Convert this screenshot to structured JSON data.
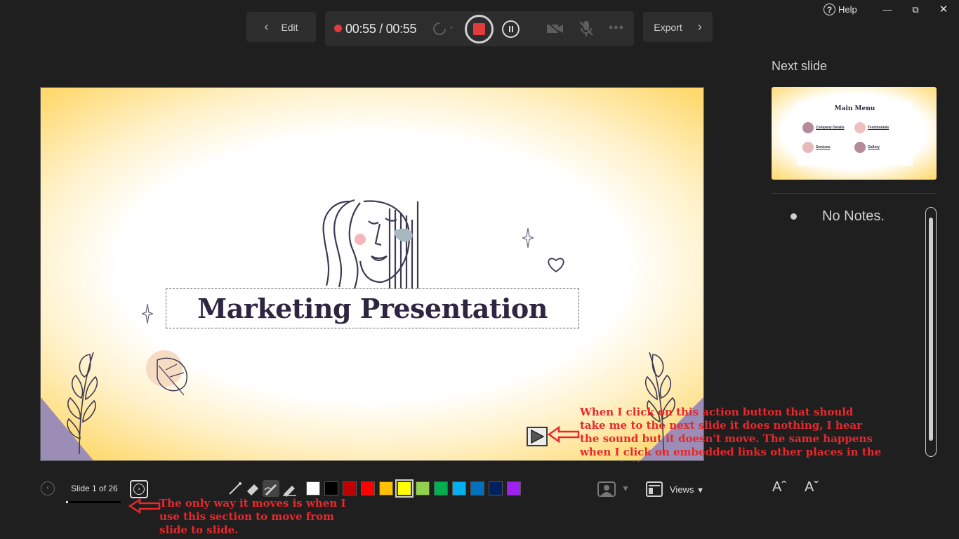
{
  "toolbar": {
    "edit_label": "Edit",
    "timer": "00:55 / 00:55",
    "export_label": "Export"
  },
  "window": {
    "help_label": "Help"
  },
  "slide": {
    "title": "Marketing Presentation"
  },
  "next_slide": {
    "label": "Next slide",
    "thumb_title": "Main Menu",
    "items": [
      "Company Details",
      "Testimonials",
      "Services",
      "Gallery"
    ]
  },
  "notes": {
    "text": "No Notes."
  },
  "navigation": {
    "slide_counter": "Slide 1 of 26",
    "progress": 0.04
  },
  "pen_colors": [
    "#ffffff",
    "#000000",
    "#c00000",
    "#ff0000",
    "#ffc000",
    "#ffff00",
    "#92d050",
    "#00b050",
    "#00b0f0",
    "#0070c0",
    "#002060",
    "#a020f0"
  ],
  "views_label": "Views",
  "font_controls": {
    "increase": "Aˆ",
    "decrease": "Aˇ"
  },
  "annotations": {
    "action_button": "When I click on this action button that should take me to the next slide it does nothing, I hear the sound but it doesn't move. The same happens when I click on embedded links other places in the presentation",
    "navigation": "The only way it moves is when I use this section to move from slide to slide."
  }
}
